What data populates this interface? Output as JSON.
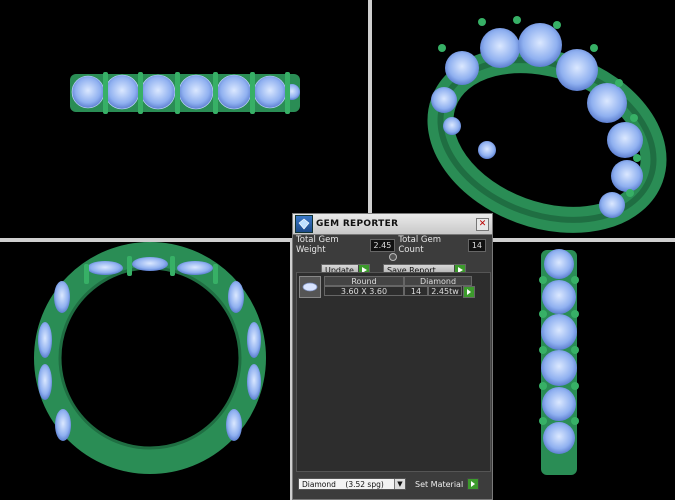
{
  "panel": {
    "title": "GEM REPORTER",
    "total_gem_weight_label": "Total Gem Weight",
    "total_gem_weight_value": "2.45",
    "total_gem_count_label": "Total Gem Count",
    "total_gem_count_value": "14",
    "update_label": "Update",
    "save_report_label": "Save Report",
    "list": {
      "headers": {
        "shape": "Round",
        "material": "Diamond"
      },
      "row": {
        "size": "3.60 X 3.60",
        "count": "14",
        "weight": "2.45tw"
      }
    },
    "material_select": {
      "value": "Diamond",
      "detail": "(3.52 spg)"
    },
    "set_material_label": "Set Material"
  },
  "icons": {
    "logo": "gem-reporter-logo-icon",
    "close": "close-icon",
    "go": "play-arrow-icon",
    "gem_thumbnail": "round-gem-icon",
    "dropdown": "chevron-down-icon"
  },
  "colors": {
    "metal": "#2f9b5e",
    "gem": "#8fb8f5",
    "accent_green": "#3c9a2c"
  }
}
